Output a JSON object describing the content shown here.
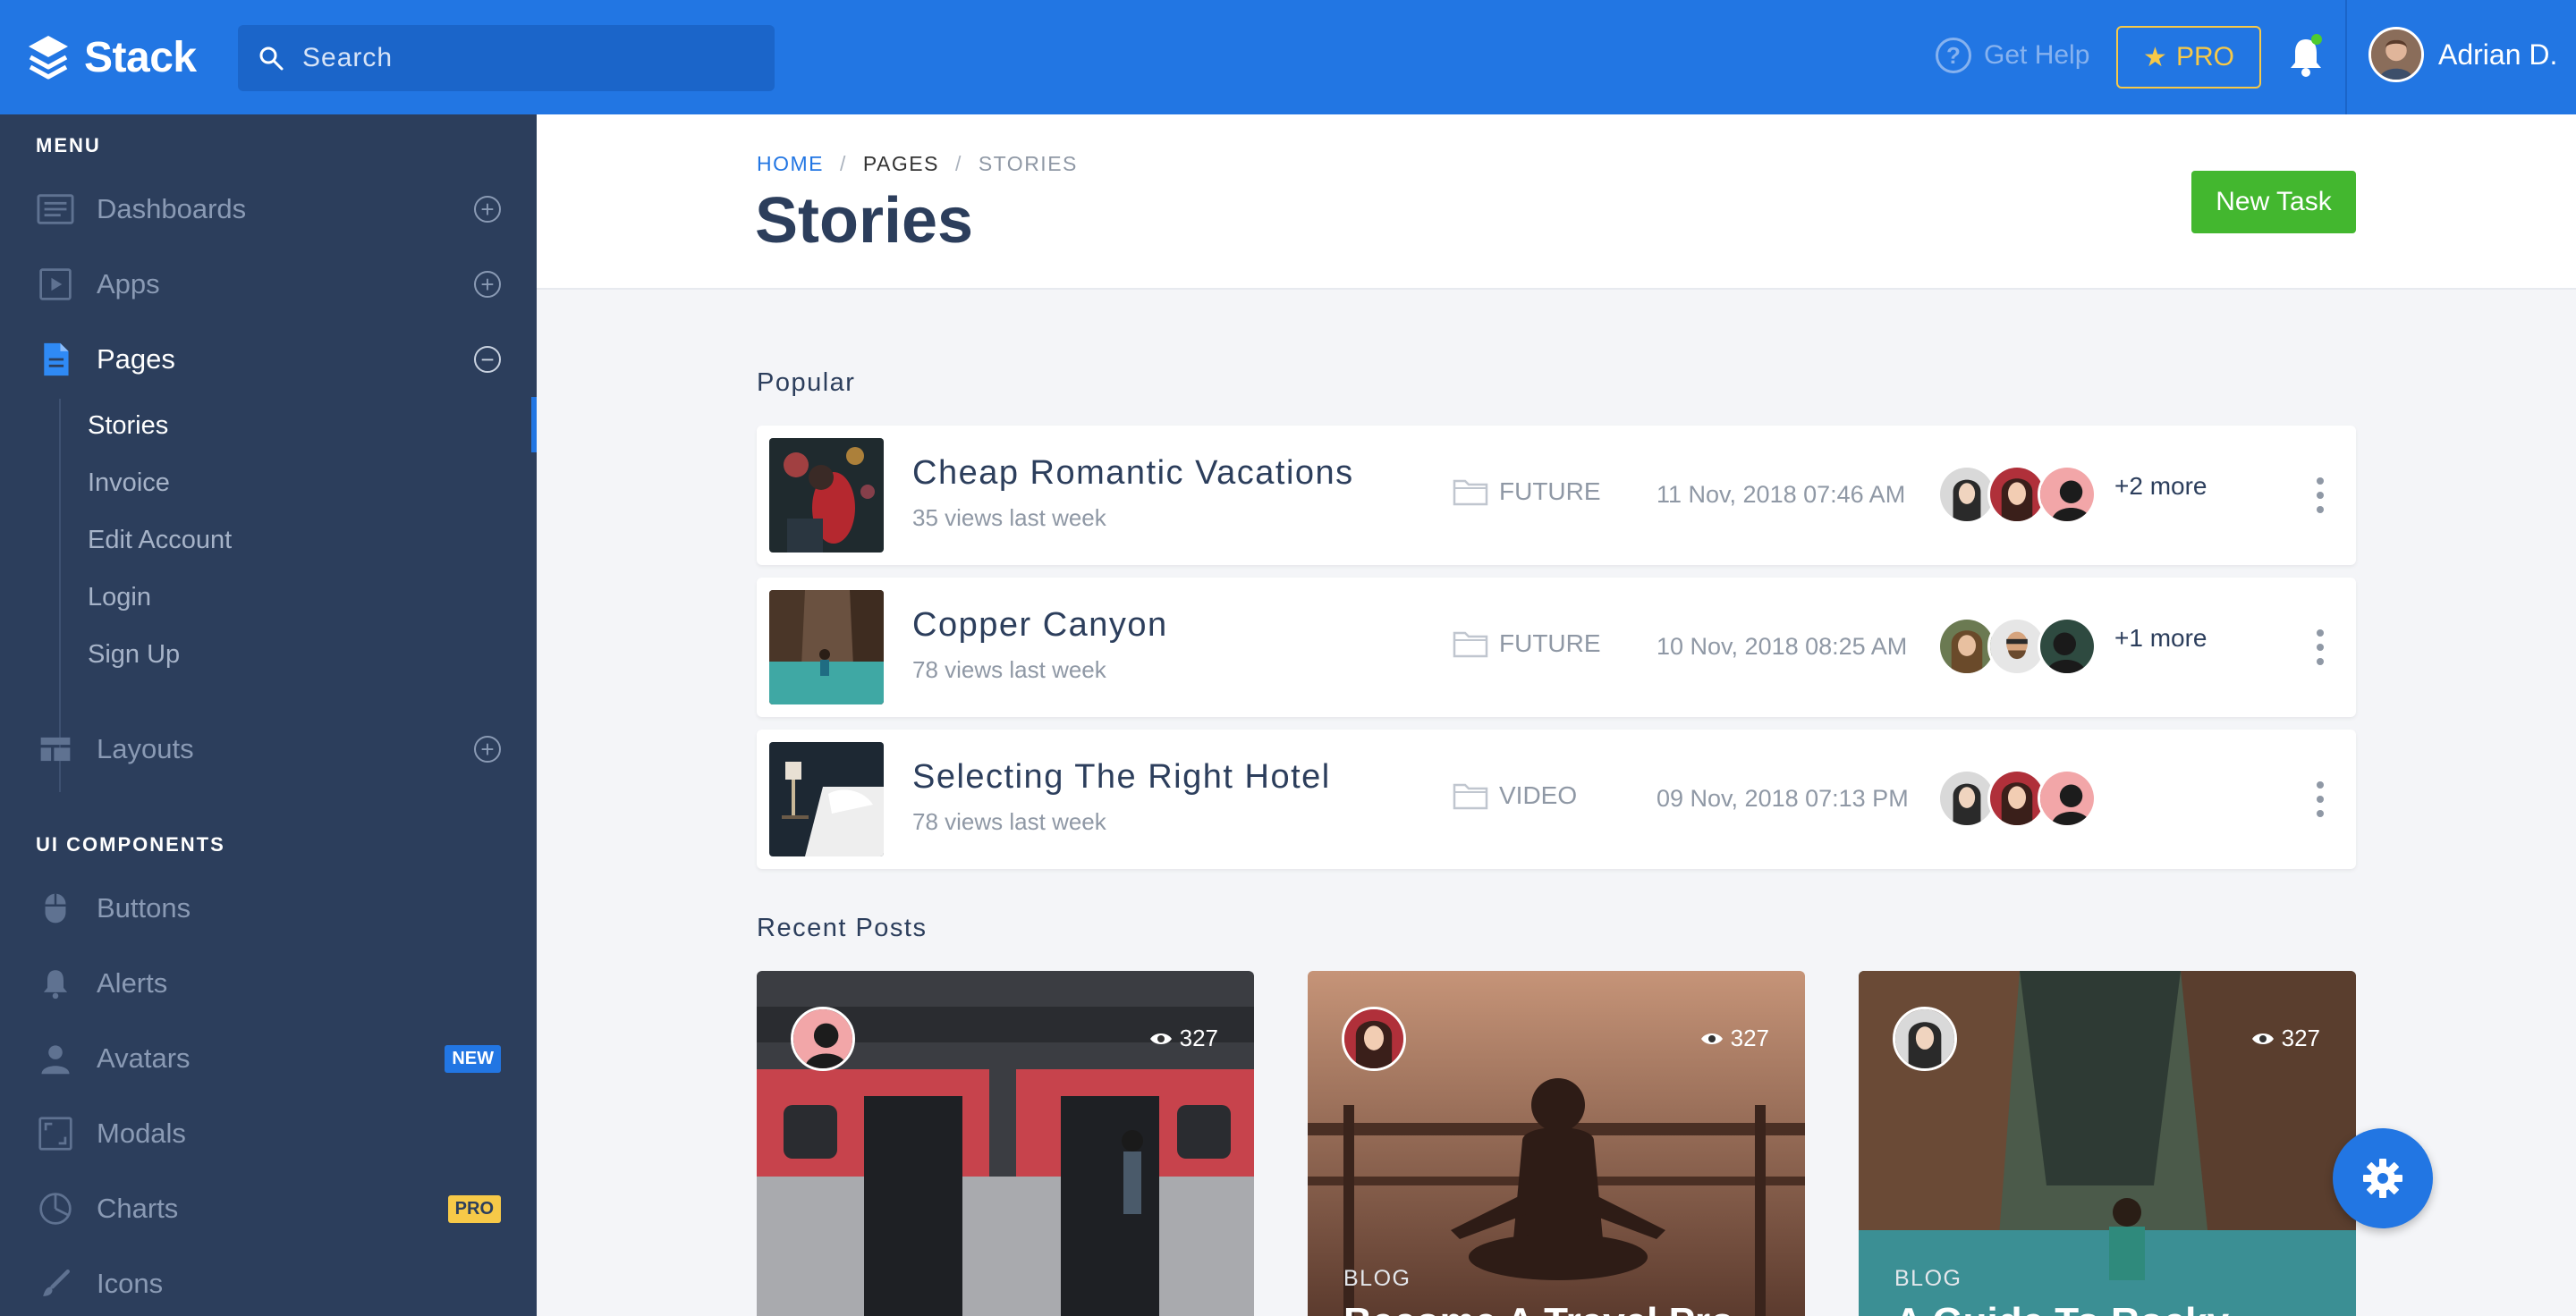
{
  "app": {
    "logo_text": "Stack"
  },
  "topbar": {
    "search_placeholder": "Search",
    "get_help": "Get Help",
    "pro_label": "PRO",
    "user_name": "Adrian D."
  },
  "sidebar": {
    "menu_heading": "MENU",
    "items": [
      {
        "label": "Dashboards",
        "icon": "dashboard-icon"
      },
      {
        "label": "Apps",
        "icon": "apps-icon"
      },
      {
        "label": "Pages",
        "icon": "pages-icon"
      }
    ],
    "pages_sub": [
      "Stories",
      "Invoice",
      "Edit Account",
      "Login",
      "Sign Up"
    ],
    "layouts_label": "Layouts",
    "ui_heading": "UI COMPONENTS",
    "ui_items": [
      {
        "label": "Buttons",
        "icon": "mouse-icon"
      },
      {
        "label": "Alerts",
        "icon": "bell-icon"
      },
      {
        "label": "Avatars",
        "icon": "person-icon",
        "badge": "NEW"
      },
      {
        "label": "Modals",
        "icon": "modal-icon"
      },
      {
        "label": "Charts",
        "icon": "pie-chart-icon",
        "badge": "PRO"
      },
      {
        "label": "Icons",
        "icon": "brush-icon"
      }
    ]
  },
  "breadcrumb": {
    "home": "HOME",
    "sep": "/",
    "pages": "PAGES",
    "current": "STORIES"
  },
  "page": {
    "title": "Stories",
    "new_task": "New Task"
  },
  "popular": {
    "heading": "Popular",
    "stories": [
      {
        "title": "Cheap Romantic Vacations",
        "views": "35 views last week",
        "category": "FUTURE",
        "date": "11 Nov, 2018 07:46 AM",
        "more": "+2 more"
      },
      {
        "title": "Copper Canyon",
        "views": "78 views last week",
        "category": "FUTURE",
        "date": "10 Nov, 2018 08:25 AM",
        "more": "+1 more"
      },
      {
        "title": "Selecting The Right Hotel",
        "views": "78 views last week",
        "category": "VIDEO",
        "date": "09 Nov, 2018 07:13 PM",
        "more": ""
      }
    ]
  },
  "recent": {
    "heading": "Recent Posts",
    "posts": [
      {
        "views": "327",
        "category": "",
        "title": ""
      },
      {
        "views": "327",
        "category": "BLOG",
        "title": "Become A Travel Pro"
      },
      {
        "views": "327",
        "category": "BLOG",
        "title": "A Guide To Rocky"
      }
    ]
  },
  "colors": {
    "primary": "#2276e3",
    "sidebar": "#2c3e5c",
    "success": "#43b72f",
    "pro": "#f7c948"
  }
}
